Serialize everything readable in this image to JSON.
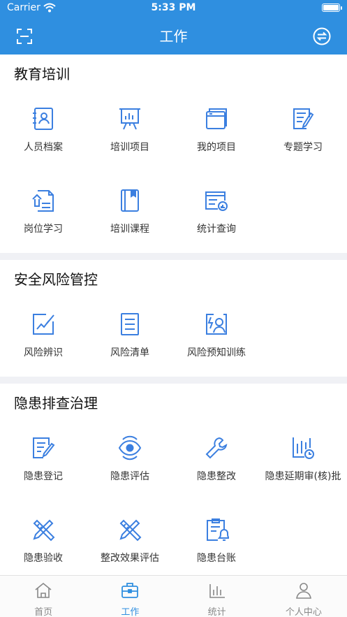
{
  "status_bar": {
    "carrier": "Carrier",
    "time": "5:33 PM"
  },
  "navbar": {
    "title": "工作",
    "left_icon": "scan-icon",
    "right_icon": "switch-icon"
  },
  "sections": [
    {
      "title": "教育培训",
      "items": [
        {
          "label": "人员档案",
          "icon": "personnel-file-icon"
        },
        {
          "label": "培训项目",
          "icon": "training-board-icon"
        },
        {
          "label": "我的项目",
          "icon": "my-projects-icon"
        },
        {
          "label": "专题学习",
          "icon": "topic-study-icon"
        },
        {
          "label": "岗位学习",
          "icon": "post-study-icon"
        },
        {
          "label": "培训课程",
          "icon": "course-book-icon"
        },
        {
          "label": "统计查询",
          "icon": "statistics-query-icon"
        }
      ]
    },
    {
      "title": "安全风险管控",
      "items": [
        {
          "label": "风险辨识",
          "icon": "risk-identify-icon"
        },
        {
          "label": "风险清单",
          "icon": "risk-list-icon"
        },
        {
          "label": "风险预知训练",
          "icon": "risk-training-icon"
        }
      ]
    },
    {
      "title": "隐患排查治理",
      "items": [
        {
          "label": "隐患登记",
          "icon": "hazard-register-icon"
        },
        {
          "label": "隐患评估",
          "icon": "hazard-assess-icon"
        },
        {
          "label": "隐患整改",
          "icon": "wrench-icon"
        },
        {
          "label": "隐患延期审(核)批",
          "icon": "extension-chart-icon"
        },
        {
          "label": "隐患验收",
          "icon": "acceptance-tools-icon"
        },
        {
          "label": "整改效果评估",
          "icon": "effect-tools-icon"
        },
        {
          "label": "隐患台账",
          "icon": "ledger-bell-icon"
        }
      ]
    }
  ],
  "tabbar": [
    {
      "label": "首页",
      "icon": "home-icon",
      "active": false
    },
    {
      "label": "工作",
      "icon": "briefcase-icon",
      "active": true
    },
    {
      "label": "统计",
      "icon": "stats-icon",
      "active": false
    },
    {
      "label": "个人中心",
      "icon": "user-icon",
      "active": false
    }
  ],
  "colors": {
    "primary": "#2f8fe0",
    "icon_blue": "#3b7fe0",
    "tab_inactive": "#888888",
    "divider": "#f0f1f5"
  }
}
